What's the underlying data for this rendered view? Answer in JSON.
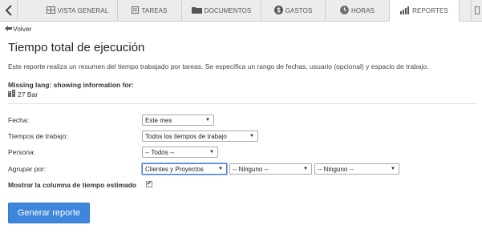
{
  "tabs": [
    {
      "label": "VISTA GENERAL",
      "icon": "grid-icon"
    },
    {
      "label": "TAREAS",
      "icon": "tasks-icon"
    },
    {
      "label": "DOCUMENTOS",
      "icon": "folder-icon"
    },
    {
      "label": "GASTOS",
      "icon": "dollar-icon"
    },
    {
      "label": "HORAS",
      "icon": "clock-icon"
    },
    {
      "label": "REPORTES",
      "icon": "bar-chart-icon",
      "active": true
    }
  ],
  "nav": {
    "back_label": "Volver"
  },
  "page": {
    "title": "Tiempo total de ejecución",
    "description": "Este reporte realiza un resumen del tiempo trabajado por tareas. Se especifica un rango de fechas, usuario (opcional) y espacio de trabajo.",
    "missing_lang": "Missing lang: showing information for:",
    "workspace": "27 Bar"
  },
  "form": {
    "fecha": {
      "label": "Fecha:",
      "value": "Este mes"
    },
    "tiempos": {
      "label": "Tiempos de trabajo:",
      "value": "Todos los tiempos de trabajo"
    },
    "persona": {
      "label": "Persona:",
      "value": "-- Todos --"
    },
    "agrupar": {
      "label": "Agrupar por:",
      "values": [
        "Clientes y Proyectos",
        "-- Ninguno --",
        "-- Ninguno --"
      ]
    },
    "estimado": {
      "label": "Mostrar la columna de tiempo estimado",
      "checked": true
    }
  },
  "actions": {
    "generate_label": "Generar reporte"
  },
  "colors": {
    "primary_button": "#3e86db",
    "tab_bar": "#ececec"
  }
}
